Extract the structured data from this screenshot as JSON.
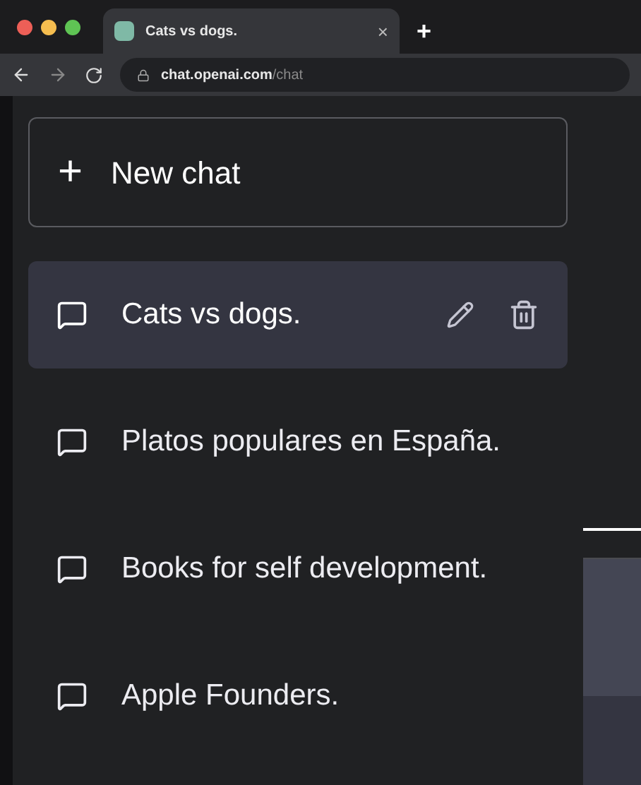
{
  "browser": {
    "tab": {
      "title": "Cats vs dogs.",
      "close": "×"
    },
    "new_tab": "+",
    "url_host": "chat.openai.com",
    "url_path": "/chat"
  },
  "sidebar": {
    "new_chat": {
      "icon": "+",
      "label": "New chat"
    },
    "chats": [
      {
        "title": "Cats vs dogs.",
        "selected": true
      },
      {
        "title": "Platos populares en España.",
        "selected": false
      },
      {
        "title": "Books for self development.",
        "selected": false
      },
      {
        "title": "Apple Founders.",
        "selected": false
      }
    ]
  }
}
